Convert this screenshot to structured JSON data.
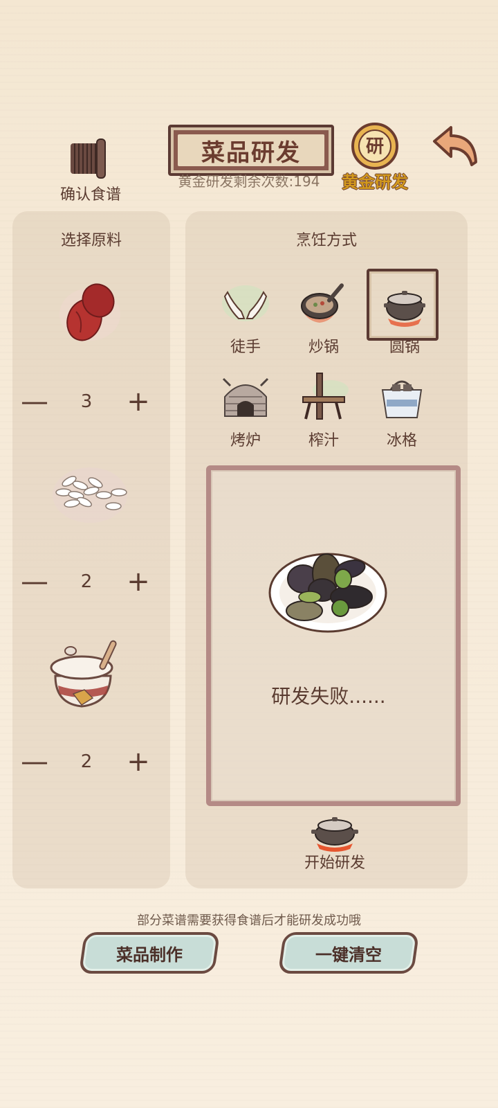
{
  "header": {
    "title": "菜品研发",
    "gold_remaining": "黄金研发剩余次数:194",
    "confirm_recipe_label": "确认食谱",
    "gold_research_label": "黄金研发",
    "gold_badge": "研"
  },
  "ingredients_panel": {
    "title": "选择原料",
    "items": [
      {
        "name": "red-date-icon",
        "quantity": "3"
      },
      {
        "name": "rice-icon",
        "quantity": "2"
      },
      {
        "name": "sugar-pot-icon",
        "quantity": "2"
      }
    ],
    "minus": "—",
    "plus": "+"
  },
  "cooking_panel": {
    "title": "烹饪方式",
    "methods": [
      {
        "label": "徒手",
        "icon": "hands-icon",
        "selected": false
      },
      {
        "label": "炒锅",
        "icon": "wok-icon",
        "selected": false
      },
      {
        "label": "圆锅",
        "icon": "round-pot-icon",
        "selected": true
      },
      {
        "label": "烤炉",
        "icon": "oven-icon",
        "selected": false
      },
      {
        "label": "榨汁",
        "icon": "juicer-icon",
        "selected": false
      },
      {
        "label": "冰格",
        "icon": "ice-box-icon",
        "selected": false
      }
    ],
    "result_text": "研发失败......",
    "start_label": "开始研发"
  },
  "footer": {
    "hint": "部分菜谱需要获得食谱后才能研发成功哦",
    "make_dish": "菜品制作",
    "clear_all": "一键清空"
  },
  "colors": {
    "accent_brown": "#5b3a33",
    "button_mint": "#c8ddd7",
    "gold": "#d39a1e"
  }
}
